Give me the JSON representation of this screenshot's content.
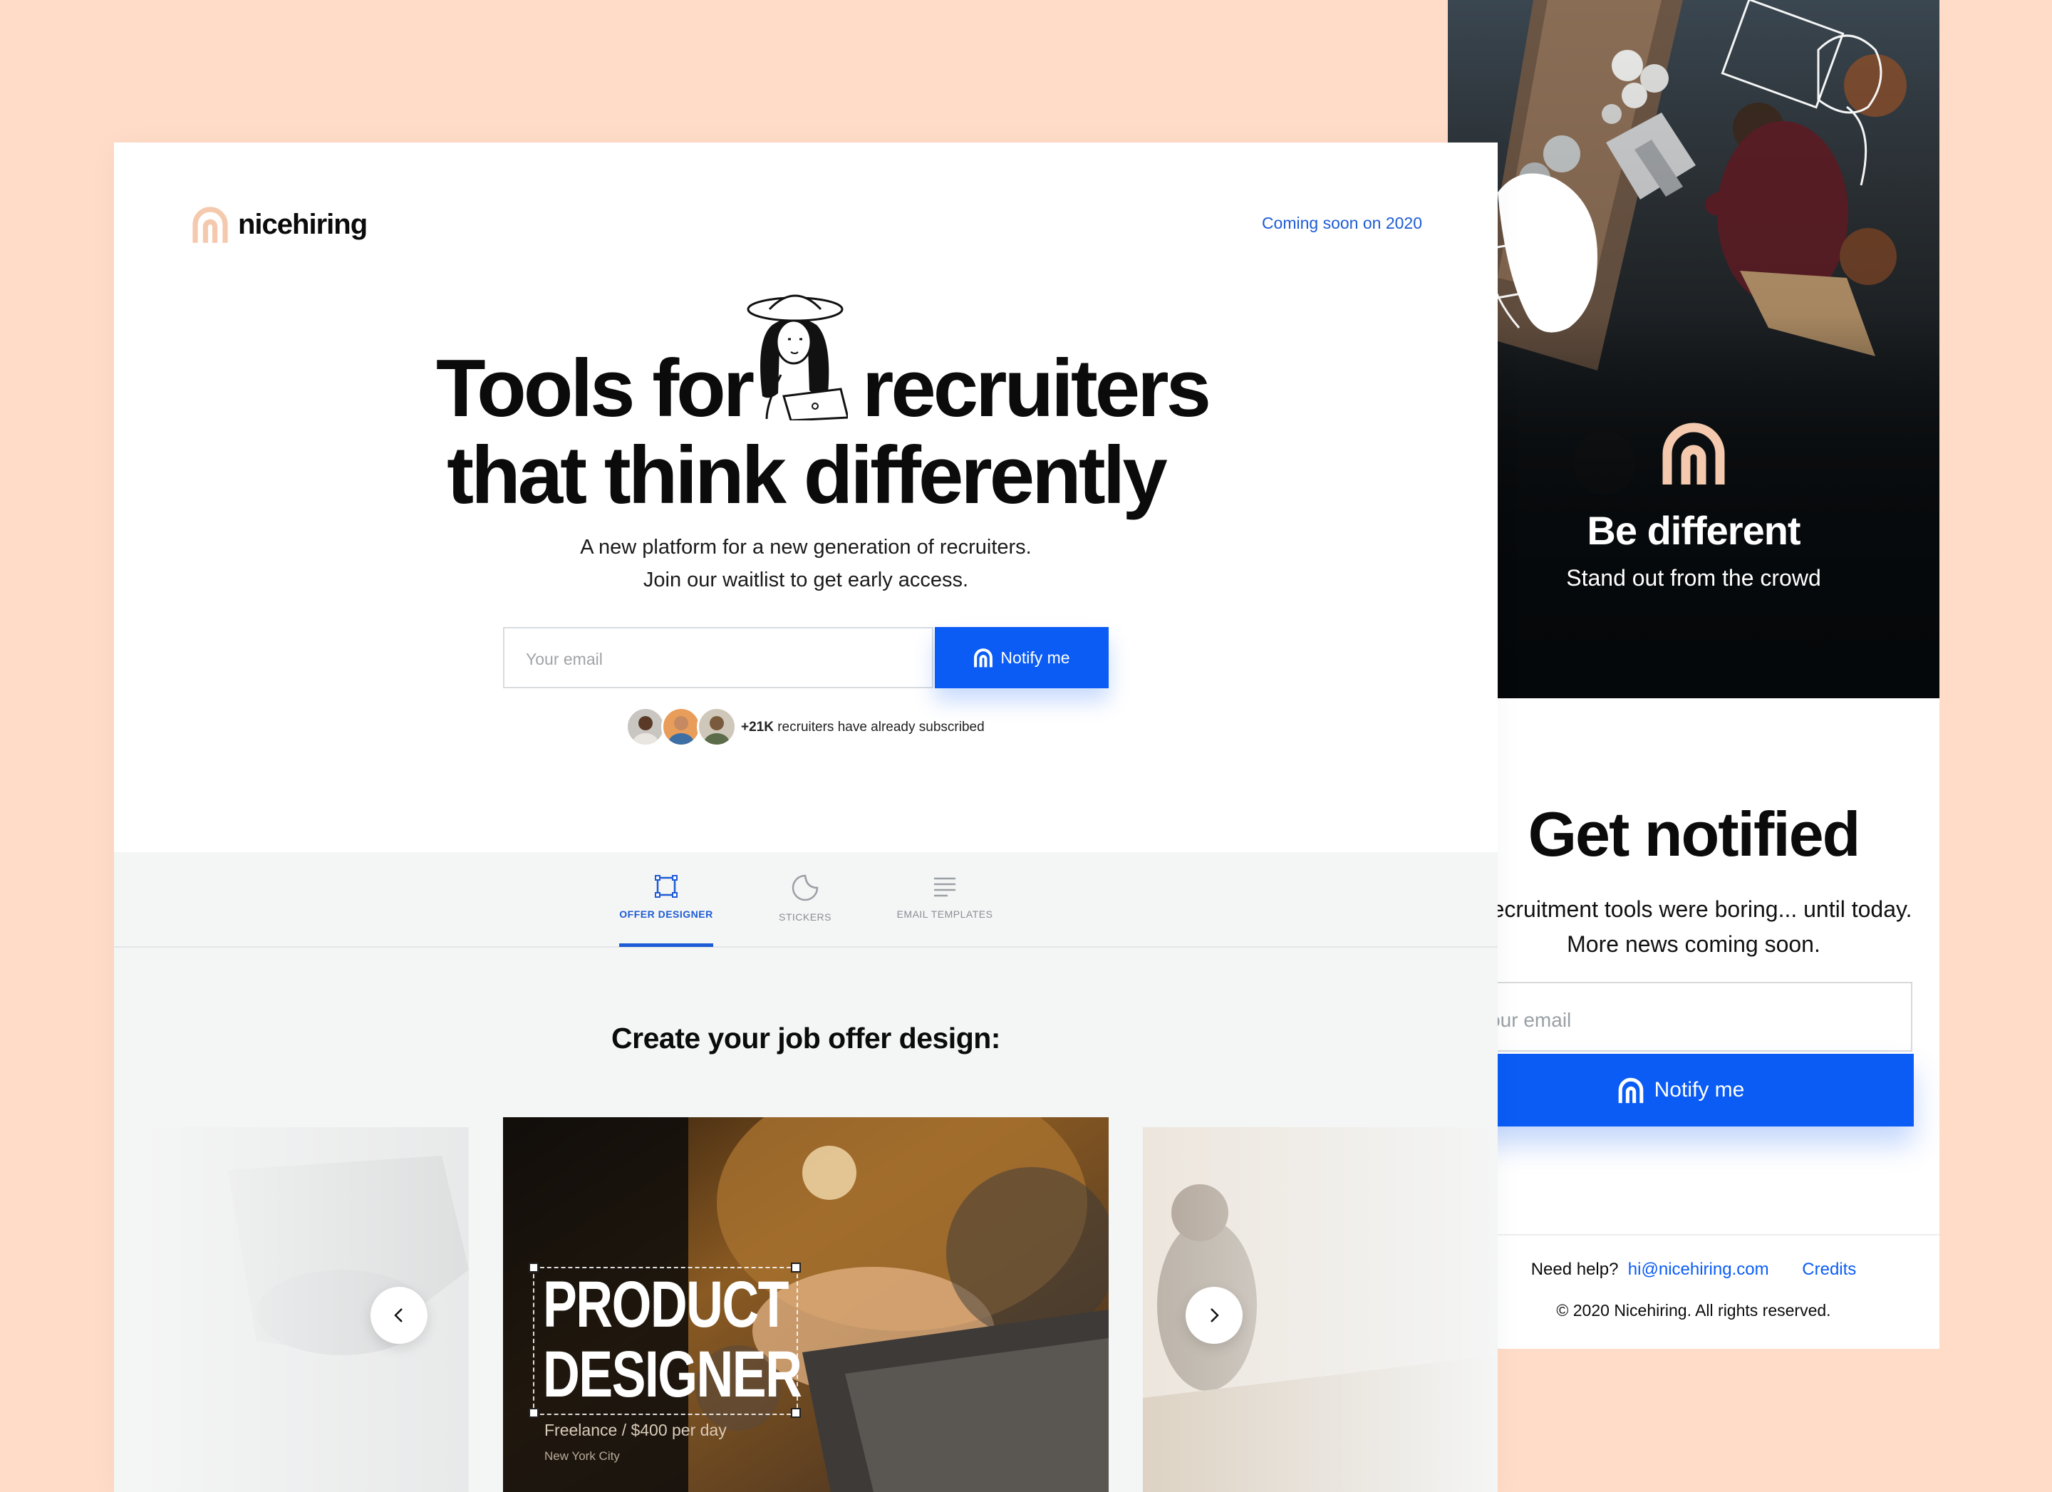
{
  "colors": {
    "background": "#ffdcc7",
    "accent": "#0a5cf5",
    "link": "#1d5cd6",
    "logo": "#f4c9ad"
  },
  "desktop": {
    "brand": {
      "name": "nicehiring",
      "logo_icon": "arch-logo-icon"
    },
    "coming_soon": "Coming soon on 2020",
    "headline": {
      "line1_a": "Tools for",
      "line1_b": "recruiters",
      "line2": "that think differently"
    },
    "subtitle": {
      "line1": "A new platform for a new generation of recruiters.",
      "line2": "Join our waitlist to get early access."
    },
    "form": {
      "email_placeholder": "Your email",
      "button_label": "Notify me"
    },
    "social_proof": {
      "count": "+21K",
      "text": "recruiters have already subscribed"
    },
    "tabs": [
      {
        "label": "OFFER DESIGNER",
        "icon": "frame-icon",
        "active": true
      },
      {
        "label": "STICKERS",
        "icon": "sticker-icon",
        "active": false
      },
      {
        "label": "EMAIL TEMPLATES",
        "icon": "lines-icon",
        "active": false
      }
    ],
    "section_title": "Create your job offer design:",
    "slide": {
      "title_line1": "PRODUCT",
      "title_line2": "DESIGNER",
      "subtitle": "Freelance / $400 per day",
      "location": "New York City"
    }
  },
  "mobile": {
    "hero_title": "Be different",
    "hero_subtitle": "Stand out from the crowd",
    "title": "Get notified",
    "subtitle_line1": "Recruitment tools were boring... until today.",
    "subtitle_line2": "More news coming soon.",
    "email_placeholder": "Your email",
    "button_label": "Notify me",
    "help_label": "Need help?",
    "help_email": "hi@nicehiring.com",
    "credits": "Credits",
    "copyright": "© 2020 Nicehiring. All rights reserved."
  }
}
